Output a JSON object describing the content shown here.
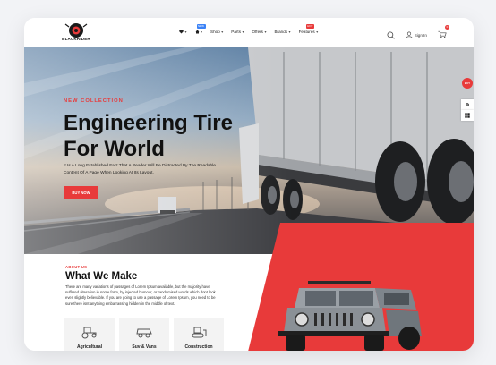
{
  "brand": {
    "name": "BLACKRIDER"
  },
  "nav": {
    "items": [
      {
        "label": "",
        "icon": "heart-icon",
        "badge": ""
      },
      {
        "label": "",
        "icon": "home-icon",
        "badge": "NEW"
      },
      {
        "label": "Shop",
        "badge": ""
      },
      {
        "label": "Parts",
        "badge": ""
      },
      {
        "label": "Offers",
        "badge": ""
      },
      {
        "label": "Brands",
        "badge": ""
      },
      {
        "label": "Features",
        "badge": "HOT"
      }
    ],
    "sign_in": "Sign In",
    "cart_count": "0"
  },
  "hero": {
    "kicker": "NEW COLLECTION",
    "title_line1": "Engineering Tire",
    "title_line2": "For World",
    "description": "It Is A Long Established Fact That A Reader Will Be Distracted By The Readable Content Of A Page When Looking At Its Layout.",
    "button": "BUY NOW"
  },
  "side_tools": {
    "buy_label": "BUY"
  },
  "about": {
    "kicker": "ABOUT US",
    "title": "What We Make",
    "text": "There are many variations of passages of Lorem Ipsum available, but the majority have suffered alteration in some form, by injected humour, or randomised words which dont look even slightly believable. If you are going to use a passage of Lorem Ipsum, you need to be sure there isnt anything embarrassing hidden in the middle of text.",
    "categories": [
      {
        "label": "Agricultural",
        "icon": "tractor-icon"
      },
      {
        "label": "Suv & Vans",
        "icon": "suv-icon"
      },
      {
        "label": "Construction",
        "icon": "bulldozer-icon"
      }
    ]
  },
  "colors": {
    "accent": "#e83a3a",
    "badge_blue": "#3b82f6"
  }
}
